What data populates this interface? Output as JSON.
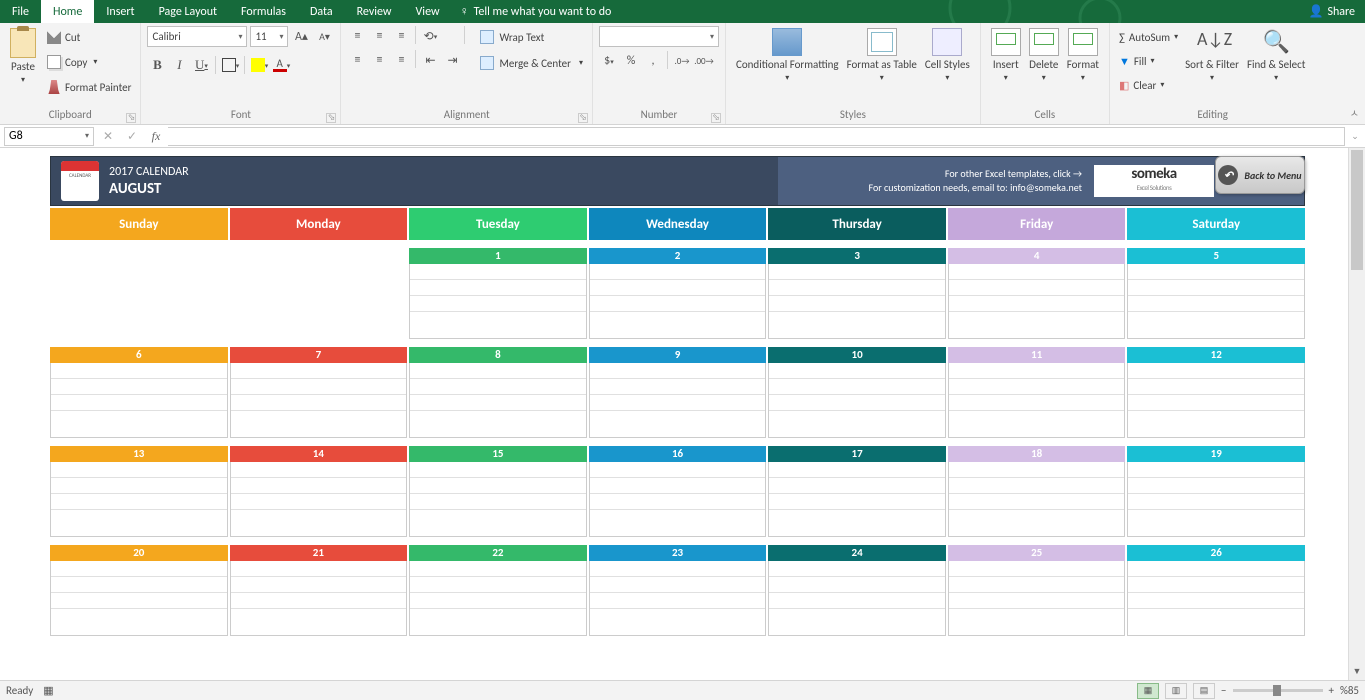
{
  "titlebar": {
    "tabs": [
      "File",
      "Home",
      "Insert",
      "Page Layout",
      "Formulas",
      "Data",
      "Review",
      "View"
    ],
    "active_tab": "Home",
    "tellme": "Tell me what you want to do",
    "share": "Share"
  },
  "ribbon": {
    "clipboard": {
      "label": "Clipboard",
      "paste": "Paste",
      "cut": "Cut",
      "copy": "Copy",
      "fp": "Format Painter"
    },
    "font": {
      "label": "Font",
      "name": "Calibri",
      "size": "11"
    },
    "alignment": {
      "label": "Alignment",
      "wrap": "Wrap Text",
      "merge": "Merge & Center"
    },
    "number": {
      "label": "Number",
      "cat": ""
    },
    "styles": {
      "label": "Styles",
      "cf": "Conditional Formatting",
      "fat": "Format as Table",
      "cs": "Cell Styles"
    },
    "cells": {
      "label": "Cells",
      "insert": "Insert",
      "delete": "Delete",
      "format": "Format"
    },
    "editing": {
      "label": "Editing",
      "autosum": "AutoSum",
      "fill": "Fill",
      "clear": "Clear",
      "sort": "Sort & Filter",
      "find": "Find & Select"
    }
  },
  "formula": {
    "namebox": "G8",
    "value": ""
  },
  "calendar": {
    "year": "2017 CALENDAR",
    "month": "AUGUST",
    "note1": "For other Excel templates, click →",
    "note2": "For customization needs, email to: info@someka.net",
    "brand": "someka",
    "brand_sub": "Excel Solutions",
    "back": "Back to Menu",
    "days": [
      "Sunday",
      "Monday",
      "Tuesday",
      "Wednesday",
      "Thursday",
      "Friday",
      "Saturday"
    ],
    "weeks": [
      [
        null,
        null,
        "1",
        "2",
        "3",
        "4",
        "5"
      ],
      [
        "6",
        "7",
        "8",
        "9",
        "10",
        "11",
        "12"
      ],
      [
        "13",
        "14",
        "15",
        "16",
        "17",
        "18",
        "19"
      ],
      [
        "20",
        "21",
        "22",
        "23",
        "24",
        "25",
        "26"
      ]
    ]
  },
  "status": {
    "ready": "Ready",
    "zoom": "%85"
  }
}
